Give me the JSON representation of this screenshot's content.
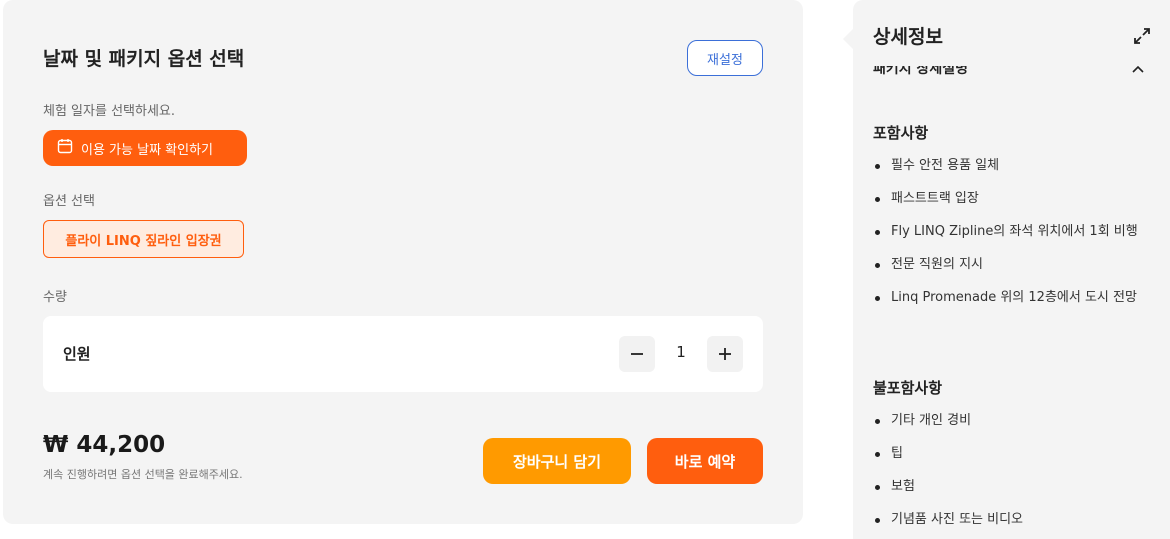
{
  "booking": {
    "title": "날짜 및 패키지 옵션 선택",
    "reset_label": "재설정",
    "date_label": "체험 일자를 선택하세요.",
    "date_button": "이용 가능 날짜 확인하기",
    "option_label": "옵션 선택",
    "option_selected": "플라이 LINQ 짚라인 입장권",
    "quantity_label": "수량",
    "quantity": {
      "row_label": "인원",
      "value": "1",
      "decrement_icon": "minus-icon",
      "increment_icon": "plus-icon"
    },
    "price": "₩ 44,200",
    "price_note": "계속 진행하려면 옵션 선택을 완료해주세요.",
    "cart_button": "장바구니 담기",
    "book_button": "바로 예약"
  },
  "details": {
    "title": "상세정보",
    "expand_icon": "expand-icon",
    "section_title": "패키지 상세설명",
    "collapse_icon": "chevron-up-icon",
    "included_heading": "포함사항",
    "included": [
      "필수 안전 용품 일체",
      "패스트트랙 입장",
      "Fly LINQ Zipline의 좌석 위치에서 1회 비행",
      "전문 직원의 지시",
      "Linq Promenade 위의 12층에서 도시 전망"
    ],
    "excluded_heading": "불포함사항",
    "excluded": [
      "기타 개인 경비",
      "팁",
      "보험",
      "기념품 사진 또는 비디오"
    ]
  },
  "colors": {
    "accent": "#ff5e0e",
    "cart": "#ff9a00",
    "reset": "#3b6fd8"
  }
}
